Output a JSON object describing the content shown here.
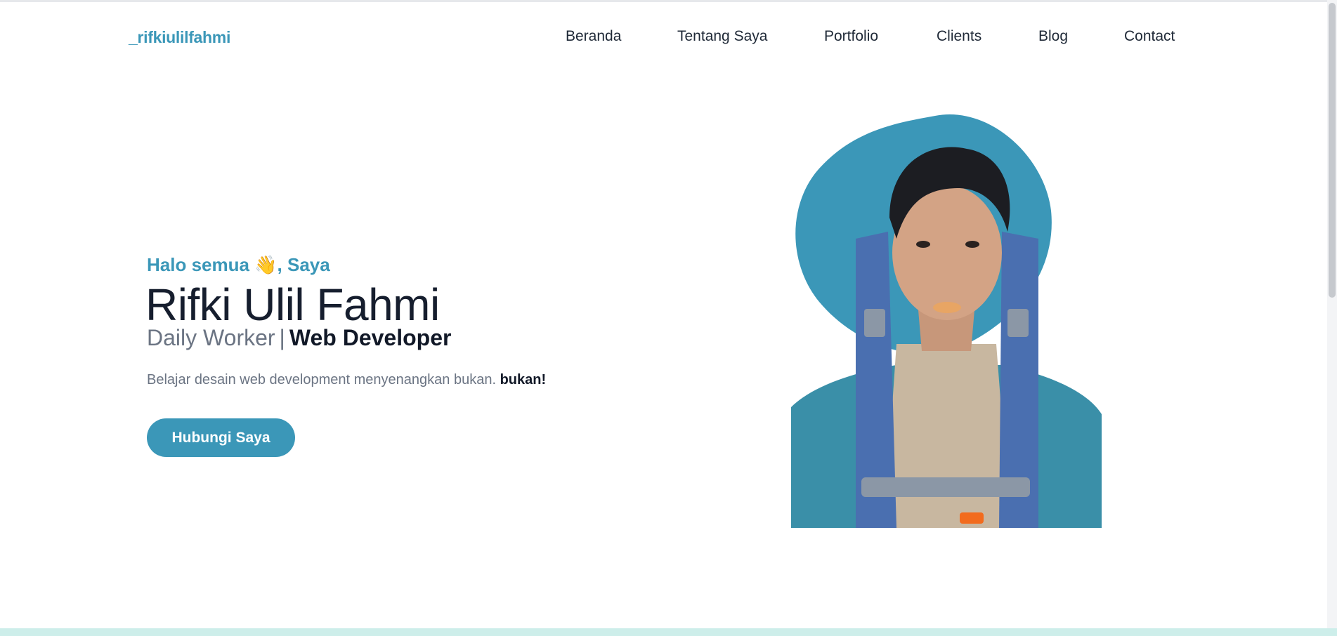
{
  "brand": "_rifkiulilfahmi",
  "nav": {
    "items": [
      {
        "label": "Beranda"
      },
      {
        "label": "Tentang Saya"
      },
      {
        "label": "Portfolio"
      },
      {
        "label": "Clients"
      },
      {
        "label": "Blog"
      },
      {
        "label": "Contact"
      }
    ]
  },
  "hero": {
    "greeting": "Halo semua 👋, Saya",
    "name": "Rifki Ulil Fahmi",
    "role_primary": "Daily Worker",
    "role_separator": "|",
    "role_secondary": "Web Developer",
    "description": "Belajar desain web development menyenangkan bukan.",
    "description_emphasis": "bukan!",
    "cta_label": "Hubungi Saya"
  },
  "colors": {
    "accent": "#3b97b8",
    "heading": "#161e2e",
    "muted": "#6b7483"
  },
  "icons": {
    "greeting_emoji": "waving-hand"
  }
}
